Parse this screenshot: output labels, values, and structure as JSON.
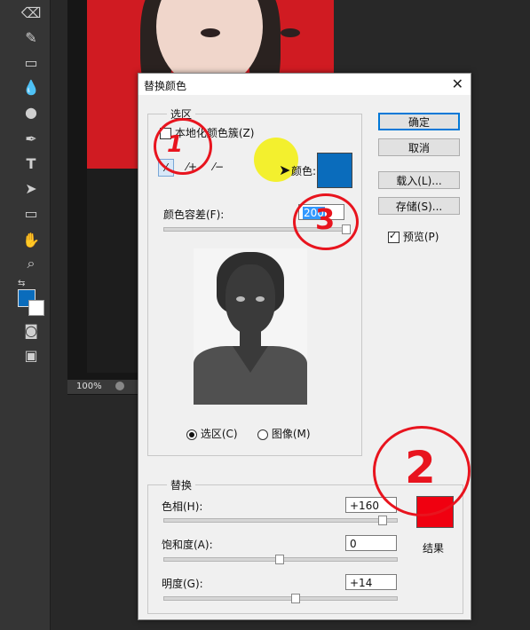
{
  "canvas": {
    "zoom": "100%"
  },
  "dialog": {
    "title": "替换颜色",
    "selection_group": "选区",
    "localized_clusters_label": "本地化颜色簇(Z)",
    "localized_clusters_checked": false,
    "color_label": "颜色:",
    "sampled_color": "#0a6cbc",
    "fuzziness_label": "颜色容差(F):",
    "fuzziness_value": "200",
    "fuzziness_fraction": 1.0,
    "view_selection_label": "选区(C)",
    "view_image_label": "图像(M)",
    "view_selected": "selection",
    "replace_group": "替换",
    "hue_label": "色相(H):",
    "hue_value": "+160",
    "hue_fraction": 0.944,
    "saturation_label": "饱和度(A):",
    "saturation_value": "0",
    "saturation_fraction": 0.5,
    "lightness_label": "明度(G):",
    "lightness_value": "+14",
    "lightness_fraction": 0.57,
    "result_label": "结果",
    "result_color": "#f00010",
    "ok_label": "确定",
    "cancel_label": "取消",
    "load_label": "载入(L)...",
    "save_label": "存储(S)...",
    "preview_label": "预览(P)",
    "preview_checked": true
  },
  "annotations": {
    "mark_1": "1",
    "mark_2": "2",
    "mark_3": "3",
    "annotation_color": "#e8141e",
    "highlight_color": "#f3f018"
  }
}
